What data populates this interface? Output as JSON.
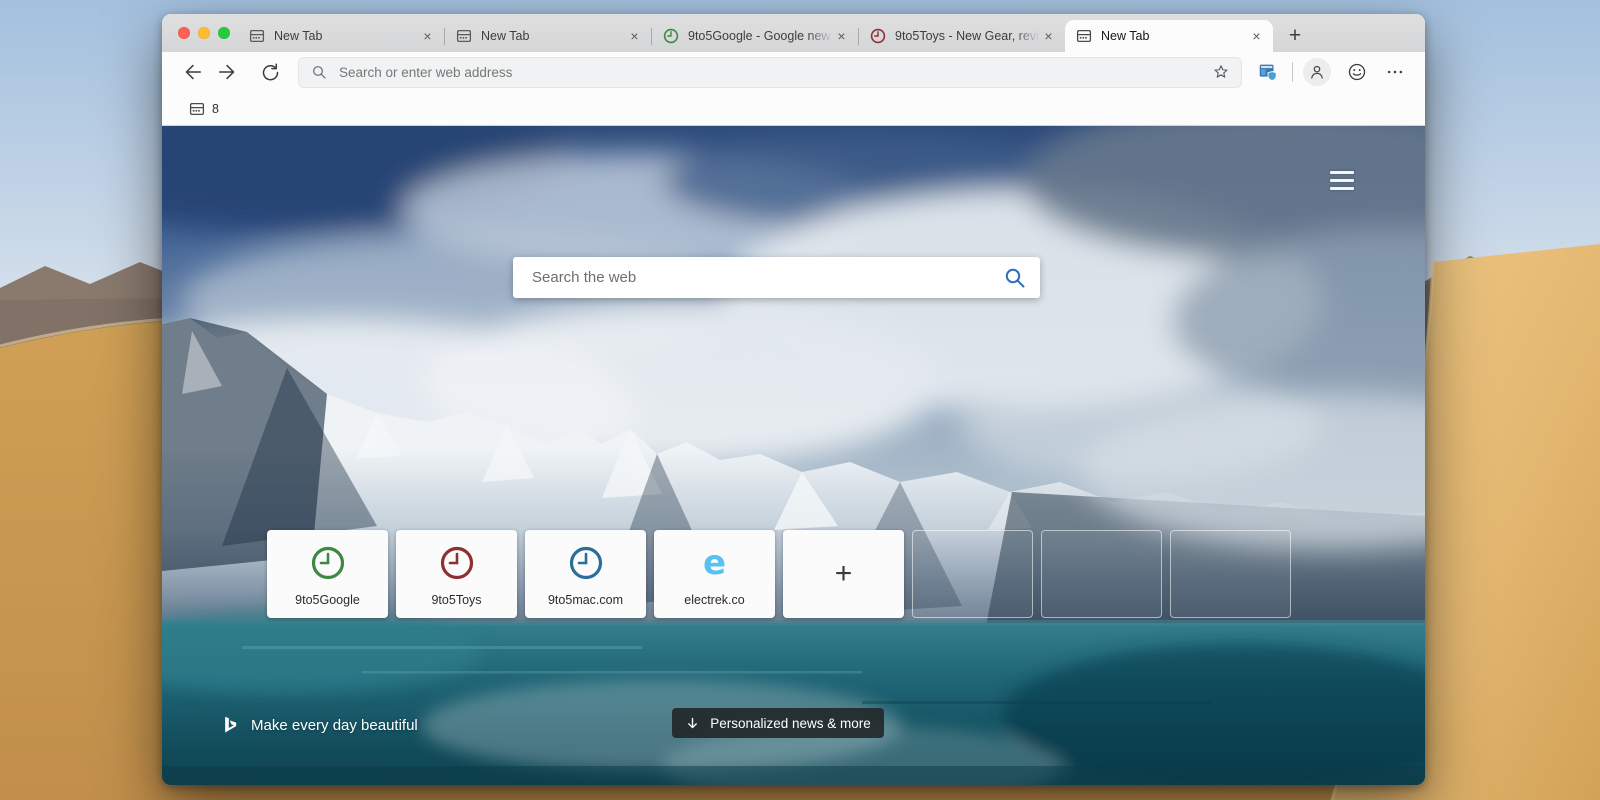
{
  "browser": {
    "traffic_lights": [
      "close",
      "minimize",
      "zoom"
    ],
    "tabs": [
      {
        "title": "New Tab",
        "icon": "newtab-window-icon",
        "active": false
      },
      {
        "title": "New Tab",
        "icon": "newtab-window-icon",
        "active": false
      },
      {
        "title": "9to5Google - Google new",
        "icon": "clock-icon-green",
        "active": false
      },
      {
        "title": "9to5Toys - New Gear, revi",
        "icon": "clock-icon-red",
        "active": false
      },
      {
        "title": "New Tab",
        "icon": "newtab-window-icon",
        "active": true
      }
    ],
    "close_glyph": "×",
    "new_tab_button": "+",
    "toolbar": {
      "address_placeholder": "Search or enter web address"
    },
    "favorites_bar": {
      "item_label": "8"
    }
  },
  "page": {
    "search_placeholder": "Search the web",
    "tiles": [
      {
        "label": "9to5Google",
        "icon": "clock-icon-green"
      },
      {
        "label": "9to5Toys",
        "icon": "clock-icon-red"
      },
      {
        "label": "9to5mac.com",
        "icon": "clock-icon-blue"
      },
      {
        "label": "electrek.co",
        "icon": "electrek-e-logo"
      },
      {
        "label": "",
        "icon": "plus-icon"
      }
    ],
    "electrek_letter": "e",
    "add_tile_glyph": "+",
    "empty_tile_count": 3,
    "footer": {
      "tagline": "Make every day beautiful",
      "news_button_label": "Personalized news & more"
    }
  },
  "colors": {
    "traffic_red": "#ff5f57",
    "traffic_yellow": "#febc2e",
    "traffic_green": "#28c840",
    "clock_green": "#3f8843",
    "clock_red": "#8c3030",
    "clock_blue": "#2a6f99",
    "electrek_blue": "#57c1f2",
    "search_icon_blue": "#2e6fbc",
    "news_pill_bg": "#202426"
  }
}
